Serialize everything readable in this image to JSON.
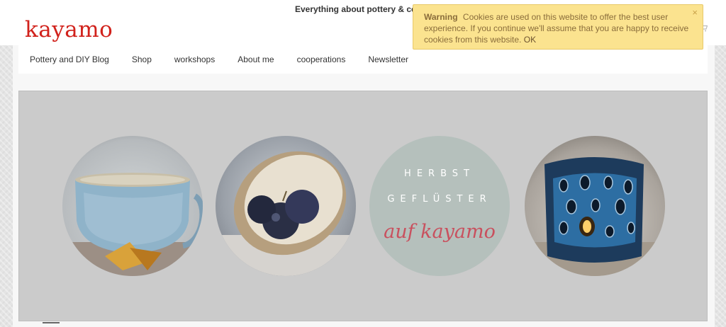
{
  "header": {
    "tagline": "Everything about pottery & cera",
    "logo": "kayamo",
    "cart_icon": "cart-icon"
  },
  "nav": {
    "items": [
      {
        "label": "Pottery and DIY Blog"
      },
      {
        "label": "Shop"
      },
      {
        "label": "workshops"
      },
      {
        "label": "About me"
      },
      {
        "label": "cooperations"
      },
      {
        "label": "Newsletter"
      }
    ]
  },
  "hero": {
    "images": [
      {
        "name": "blue-ceramic-cup-image"
      },
      {
        "name": "bowl-with-plums-image"
      },
      {
        "name": "herbst-gefluester-badge"
      },
      {
        "name": "blue-lantern-image"
      }
    ],
    "badge_line1": "HERBST",
    "badge_line2": "GEFLÜSTER",
    "badge_line3": "auf kayamo"
  },
  "cookie": {
    "title": "Warning",
    "text": "Cookies are used on this website to offer the best user experience. If you continue we'll assume that you are happy to receive cookies from this website.",
    "ok": "OK",
    "close": "×"
  },
  "colors": {
    "logo": "#d1221c",
    "cookie_bg": "#fbe38f",
    "hero_bg": "#cbcbcb",
    "badge_bg": "#b5c0bc",
    "badge_script": "#c9505e"
  }
}
